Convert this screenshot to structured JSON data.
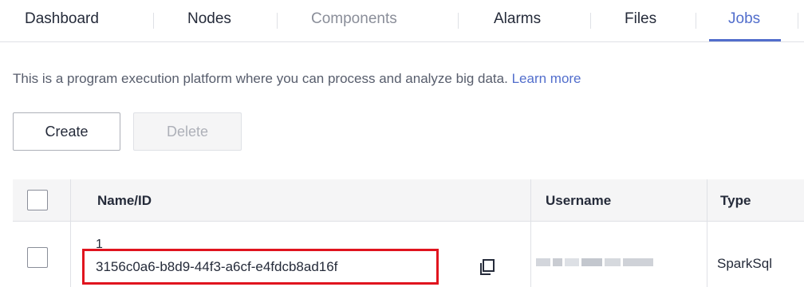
{
  "tabs": [
    {
      "label": "Dashboard",
      "state": "normal"
    },
    {
      "label": "Nodes",
      "state": "normal"
    },
    {
      "label": "Components",
      "state": "disabled"
    },
    {
      "label": "Alarms",
      "state": "normal"
    },
    {
      "label": "Files",
      "state": "normal"
    },
    {
      "label": "Jobs",
      "state": "active"
    }
  ],
  "description": {
    "text": "This is a program execution platform where you can process and analyze big data.",
    "link": "Learn more"
  },
  "toolbar": {
    "create_label": "Create",
    "delete_label": "Delete"
  },
  "table": {
    "columns": [
      "Name/ID",
      "Username",
      "Type"
    ],
    "rows": [
      {
        "name": "1",
        "id": "3156c0a6-b8d9-44f3-a6cf-e4fdcb8ad16f",
        "username": "",
        "type": "SparkSql"
      }
    ]
  },
  "colors": {
    "accent": "#526ecc",
    "highlight_border": "#e0141e"
  },
  "icons": {
    "copy": "copy-icon"
  }
}
